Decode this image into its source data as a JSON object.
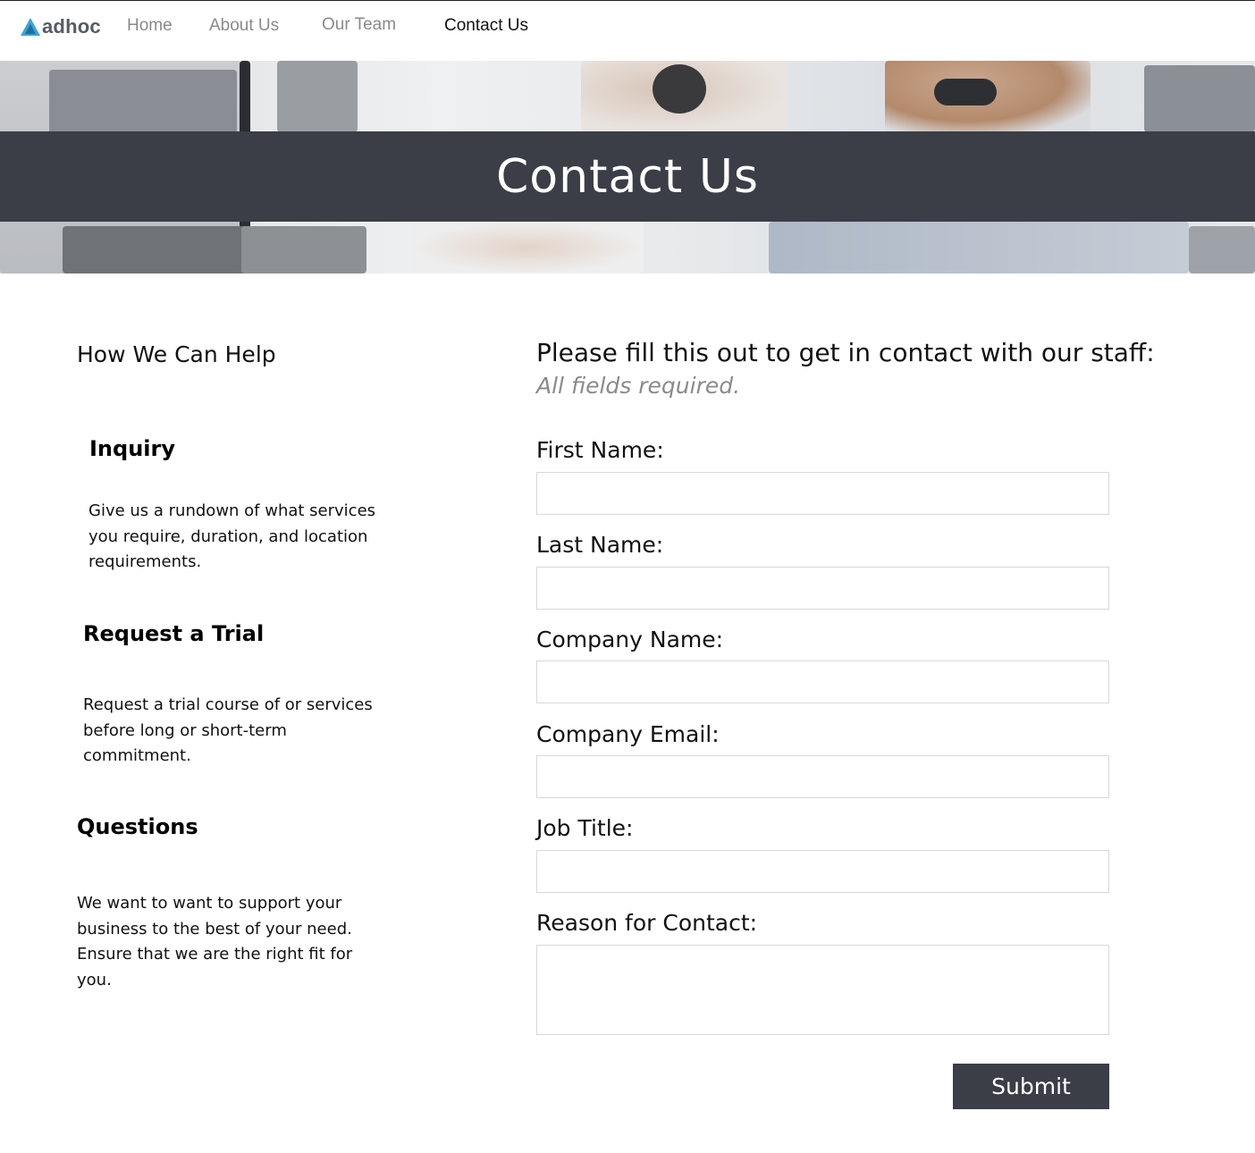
{
  "nav": {
    "logo_text": "adhoc",
    "links": [
      {
        "label": "Home"
      },
      {
        "label": "About Us"
      },
      {
        "label": "Our Team"
      },
      {
        "label": "Contact Us",
        "active": true
      }
    ]
  },
  "hero": {
    "title": "Contact Us"
  },
  "help": {
    "title": "How We Can Help",
    "blocks": [
      {
        "title": "Inquiry",
        "text": "Give us a rundown of what services you require, duration, and location requirements."
      },
      {
        "title": "Request a Trial",
        "text": "Request a trial course of or services before long or short-term commitment."
      },
      {
        "title": "Questions",
        "text": "We want to want to support your business to the best of your need. Ensure that we are the right fit for you."
      }
    ]
  },
  "form": {
    "heading": "Please fill this out to get in contact with our staff:",
    "subheading": "All fields required.",
    "fields": [
      {
        "label": "First Name:",
        "value": ""
      },
      {
        "label": "Last Name:",
        "value": ""
      },
      {
        "label": "Company Name:",
        "value": ""
      },
      {
        "label": "Company Email:",
        "value": ""
      },
      {
        "label": "Job Title:",
        "value": ""
      },
      {
        "label": "Reason for Contact:",
        "value": ""
      }
    ],
    "submit_label": "Submit"
  },
  "colors": {
    "band": "#3b3d47",
    "logo_icon": "#3aa3d8",
    "nav_inactive": "#8a8a8a"
  }
}
